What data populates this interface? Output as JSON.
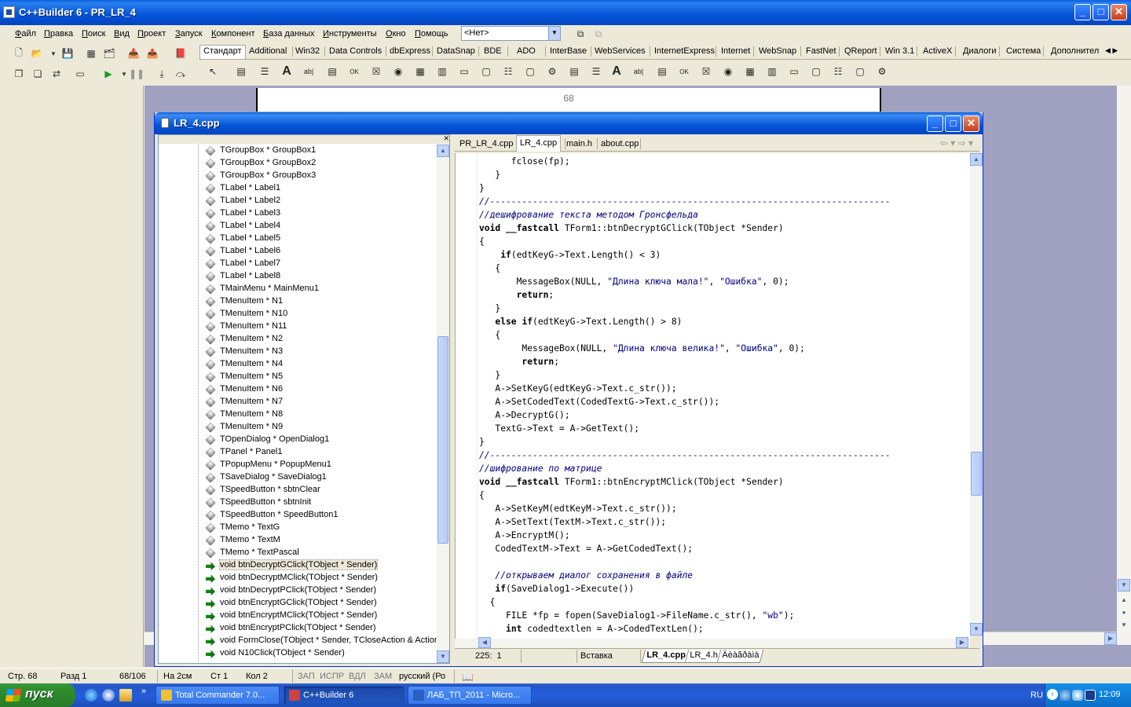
{
  "ide": {
    "title": "C++Builder 6 - PR_LR_4",
    "menu": [
      "Файл",
      "Правка",
      "Поиск",
      "Вид",
      "Проект",
      "Запуск",
      "Компонент",
      "База данных",
      "Инструменты",
      "Окно",
      "Помощь"
    ],
    "config_combo": "<Нет>",
    "palette_tabs": [
      "Стандарт",
      "Additional",
      "Win32",
      "Data Controls",
      "dbExpress",
      "DataSnap",
      "BDE",
      "ADO",
      "InterBase",
      "WebServices",
      "InternetExpress",
      "Internet",
      "WebSnap",
      "FastNet",
      "QReport",
      "Win 3.1",
      "ActiveX",
      "Диалоги",
      "Система",
      "Дополнител"
    ],
    "designer_page_number": "68"
  },
  "status_bar": {
    "page": "Стр. 68",
    "section": "Разд 1",
    "pages_total": "68/106",
    "at": "На 2см",
    "line": "Ст 1",
    "col": "Кол 2",
    "rec": "ЗАП",
    "trk": "ИСПР",
    "ext": "ВДЛ",
    "ovr": "ЗАМ",
    "lang": "русский (Ро"
  },
  "editor": {
    "title": "LR_4.cpp",
    "tabs": [
      "PR_LR_4.cpp",
      "LR_4.cpp",
      "main.h",
      "about.cpp"
    ],
    "active_tab": "LR_4.cpp",
    "cursor_pos": "225:  1",
    "insert_mode": "Вставка",
    "bottom_tabs": [
      "LR_4.cpp",
      "LR_4.h",
      "Äèàãðàìà"
    ],
    "tree": [
      {
        "kind": "obj",
        "label": "TGroupBox * GroupBox1"
      },
      {
        "kind": "obj",
        "label": "TGroupBox * GroupBox2"
      },
      {
        "kind": "obj",
        "label": "TGroupBox * GroupBox3"
      },
      {
        "kind": "obj",
        "label": "TLabel * Label1"
      },
      {
        "kind": "obj",
        "label": "TLabel * Label2"
      },
      {
        "kind": "obj",
        "label": "TLabel * Label3"
      },
      {
        "kind": "obj",
        "label": "TLabel * Label4"
      },
      {
        "kind": "obj",
        "label": "TLabel * Label5"
      },
      {
        "kind": "obj",
        "label": "TLabel * Label6"
      },
      {
        "kind": "obj",
        "label": "TLabel * Label7"
      },
      {
        "kind": "obj",
        "label": "TLabel * Label8"
      },
      {
        "kind": "obj",
        "label": "TMainMenu * MainMenu1"
      },
      {
        "kind": "obj",
        "label": "TMenuItem * N1"
      },
      {
        "kind": "obj",
        "label": "TMenuItem * N10"
      },
      {
        "kind": "obj",
        "label": "TMenuItem * N11"
      },
      {
        "kind": "obj",
        "label": "TMenuItem * N2"
      },
      {
        "kind": "obj",
        "label": "TMenuItem * N3"
      },
      {
        "kind": "obj",
        "label": "TMenuItem * N4"
      },
      {
        "kind": "obj",
        "label": "TMenuItem * N5"
      },
      {
        "kind": "obj",
        "label": "TMenuItem * N6"
      },
      {
        "kind": "obj",
        "label": "TMenuItem * N7"
      },
      {
        "kind": "obj",
        "label": "TMenuItem * N8"
      },
      {
        "kind": "obj",
        "label": "TMenuItem * N9"
      },
      {
        "kind": "obj",
        "label": "TOpenDialog * OpenDialog1"
      },
      {
        "kind": "obj",
        "label": "TPanel * Panel1"
      },
      {
        "kind": "obj",
        "label": "TPopupMenu * PopupMenu1"
      },
      {
        "kind": "obj",
        "label": "TSaveDialog * SaveDialog1"
      },
      {
        "kind": "obj",
        "label": "TSpeedButton * sbtnClear"
      },
      {
        "kind": "obj",
        "label": "TSpeedButton * sbtnInit"
      },
      {
        "kind": "obj",
        "label": "TSpeedButton * SpeedButton1"
      },
      {
        "kind": "obj",
        "label": "TMemo * TextG"
      },
      {
        "kind": "obj",
        "label": "TMemo * TextM"
      },
      {
        "kind": "obj",
        "label": "TMemo * TextPascal"
      },
      {
        "kind": "meth",
        "label": "void btnDecryptGClick(TObject * Sender)",
        "selected": true
      },
      {
        "kind": "meth",
        "label": "void btnDecryptMClick(TObject * Sender)"
      },
      {
        "kind": "meth",
        "label": "void btnDecryptPClick(TObject * Sender)"
      },
      {
        "kind": "meth",
        "label": "void btnEncryptGClick(TObject * Sender)"
      },
      {
        "kind": "meth",
        "label": "void btnEncryptMClick(TObject * Sender)"
      },
      {
        "kind": "meth",
        "label": "void btnEncryptPClick(TObject * Sender)"
      },
      {
        "kind": "meth",
        "label": "void FormClose(TObject * Sender, TCloseAction & Action)"
      },
      {
        "kind": "meth",
        "label": "void N10Click(TObject * Sender)"
      }
    ],
    "code": [
      {
        "t": "      fclose(fp);"
      },
      {
        "t": "   }"
      },
      {
        "t": "}"
      },
      {
        "t": "//---------------------------------------------------------------------------",
        "c": "cm"
      },
      {
        "t": "//дешифрование текста методом Гронсфельда",
        "c": "cm"
      },
      {
        "t": "void __fastcall TForm1::btnDecryptGClick(TObject *Sender)",
        "kw": [
          "void",
          "__fastcall"
        ]
      },
      {
        "t": "{"
      },
      {
        "t": "    if(edtKeyG->Text.Length() < 3)",
        "kw": [
          "if"
        ]
      },
      {
        "t": "   {"
      },
      {
        "t": "       MessageBox(NULL, \"Длина ключа мала!\", \"Ошибка\", 0);"
      },
      {
        "t": "       return;",
        "kw": [
          "return"
        ]
      },
      {
        "t": "   }"
      },
      {
        "t": "   else if(edtKeyG->Text.Length() > 8)",
        "kw": [
          "else",
          "if"
        ]
      },
      {
        "t": "   {"
      },
      {
        "t": "        MessageBox(NULL, \"Длина ключа велика!\", \"Ошибка\", 0);"
      },
      {
        "t": "        return;",
        "kw": [
          "return"
        ]
      },
      {
        "t": "   }"
      },
      {
        "t": "   A->SetKeyG(edtKeyG->Text.c_str());"
      },
      {
        "t": "   A->SetCodedText(CodedTextG->Text.c_str());"
      },
      {
        "t": "   A->DecryptG();"
      },
      {
        "t": "   TextG->Text = A->GetText();"
      },
      {
        "t": "}"
      },
      {
        "t": "//---------------------------------------------------------------------------",
        "c": "cm"
      },
      {
        "t": "//шифрование по матрице",
        "c": "cm"
      },
      {
        "t": "void __fastcall TForm1::btnEncryptMClick(TObject *Sender)",
        "kw": [
          "void",
          "__fastcall"
        ]
      },
      {
        "t": "{"
      },
      {
        "t": "   A->SetKeyM(edtKeyM->Text.c_str());"
      },
      {
        "t": "   A->SetText(TextM->Text.c_str());"
      },
      {
        "t": "   A->EncryptM();"
      },
      {
        "t": "   CodedTextM->Text = A->GetCodedText();"
      },
      {
        "t": ""
      },
      {
        "t": "   //открываем диалог сохранения в файле",
        "c": "cm"
      },
      {
        "t": "   if(SaveDialog1->Execute())",
        "kw": [
          "if"
        ]
      },
      {
        "t": "  {"
      },
      {
        "t": "     FILE *fp = fopen(SaveDialog1->FileName.c_str(), \"wb\");"
      },
      {
        "t": "     int codedtextlen = A->CodedTextLen();",
        "kw": [
          "int"
        ]
      }
    ]
  },
  "taskbar": {
    "start_label": "пуск",
    "tasks": [
      {
        "label": "Total Commander 7.0...",
        "color": "#f0c030"
      },
      {
        "label": "C++Builder 6",
        "color": "#d04040",
        "active": true
      },
      {
        "label": "ЛАБ_ТП_2011 - Micro...",
        "color": "#2b5fc0"
      }
    ],
    "lang": "RU",
    "clock": "12:09"
  }
}
